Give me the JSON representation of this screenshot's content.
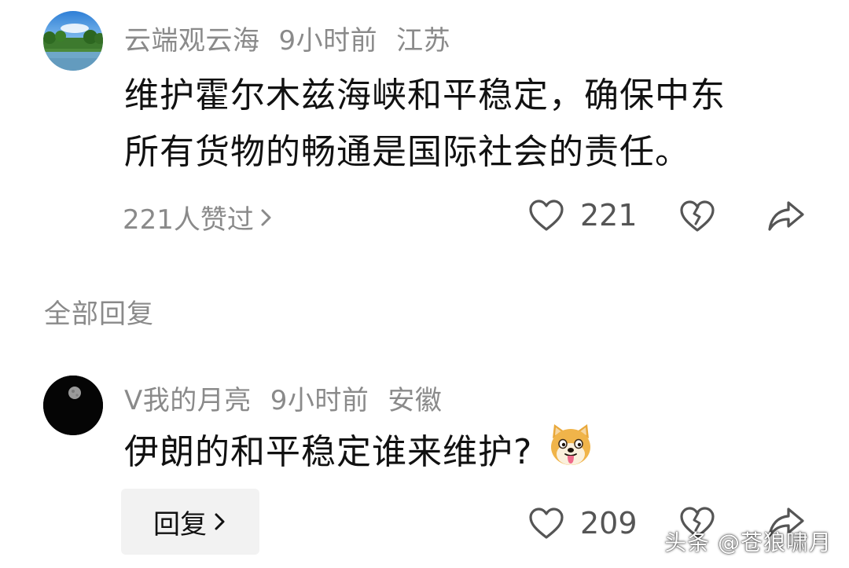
{
  "comment": {
    "author": "云端观云海",
    "time": "9小时前",
    "location": "江苏",
    "text_line1": "维护霍尔木兹海峡和平稳定，确保中东",
    "text_line2": "所有货物的畅通是国际社会的责任。",
    "likers_summary": "221人赞过",
    "like_count": "221"
  },
  "replies_section": {
    "title": "全部回复"
  },
  "reply": {
    "author": "V我的月亮",
    "time": "9小时前",
    "location": "安徽",
    "text": "伊朗的和平稳定谁来维护?",
    "emoji": "doge-emoji",
    "reply_button_label": "回复",
    "like_count": "209"
  },
  "watermark": {
    "text": "头条 @苍狼啸月"
  },
  "icons": {
    "like": "heart-outline-icon",
    "dislike": "broken-heart-icon",
    "share": "share-arrow-icon",
    "chevron": "chevron-right-icon"
  }
}
